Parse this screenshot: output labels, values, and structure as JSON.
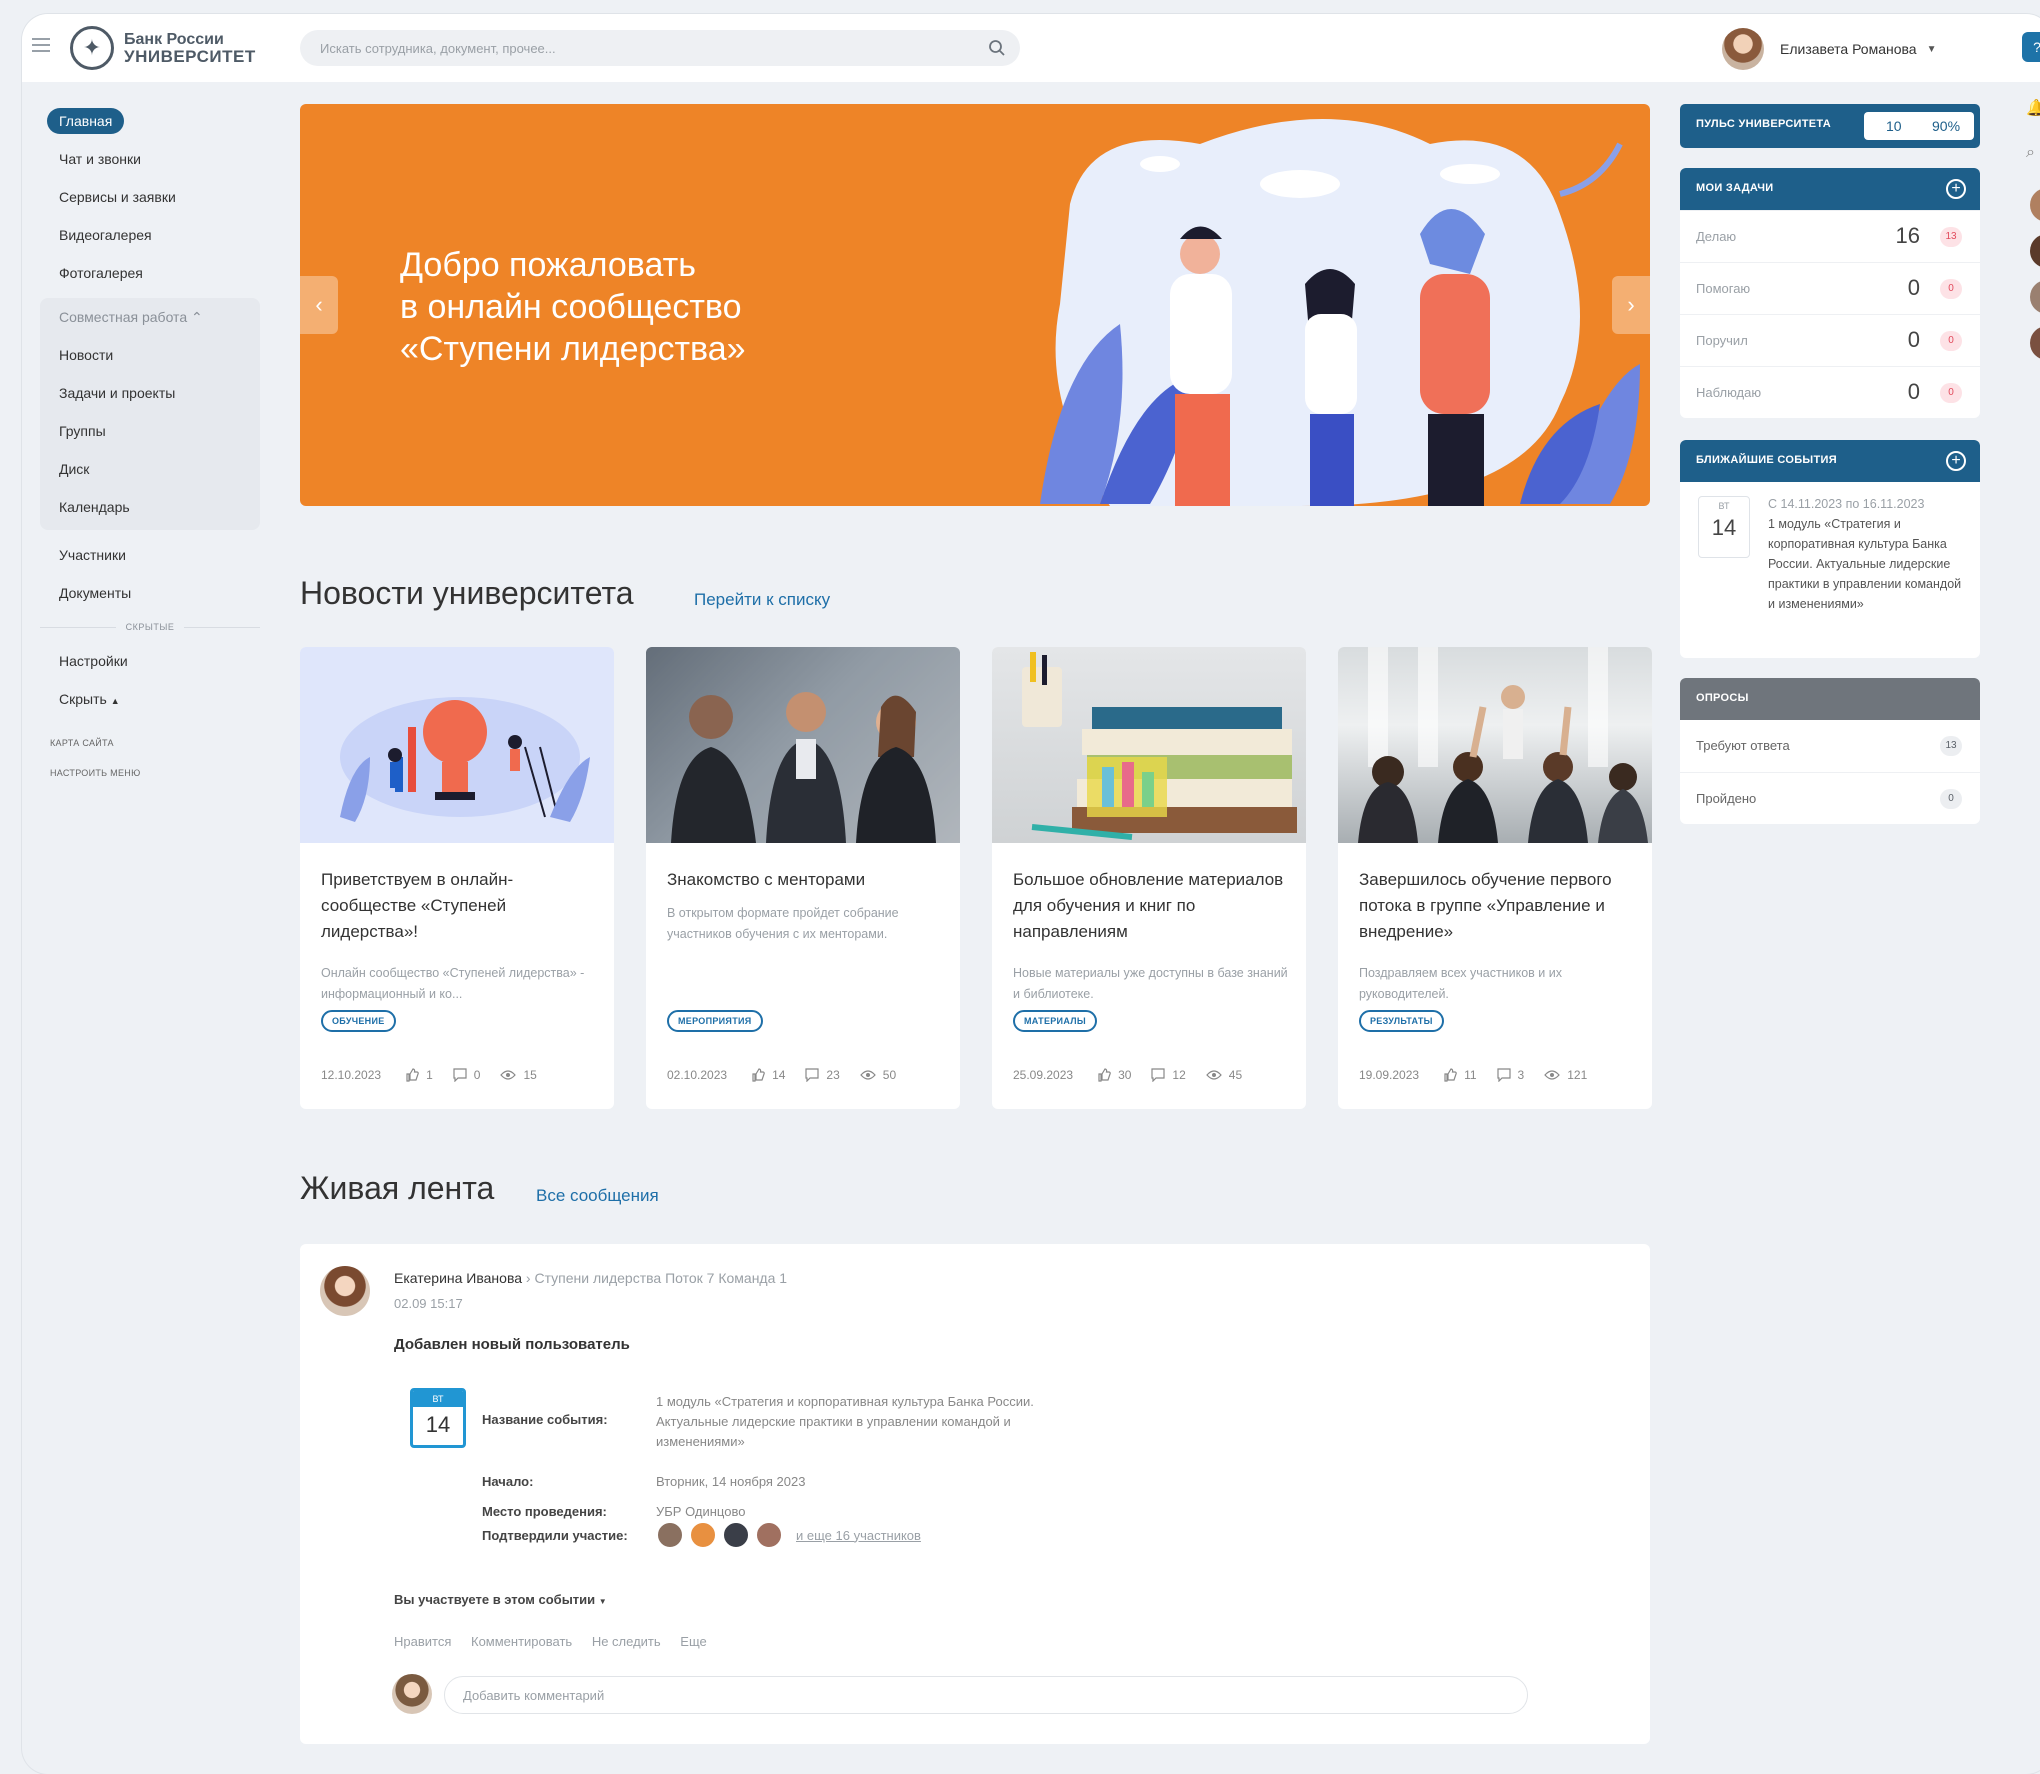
{
  "header": {
    "logo_line1": "Банк России",
    "logo_line2": "УНИВЕРСИТЕТ",
    "search_placeholder": "Искать сотрудника, документ, прочее...",
    "user_name": "Елизавета Романова",
    "help_label": "?"
  },
  "sidebar": {
    "items_top": [
      {
        "label": "Главная",
        "active": true
      },
      {
        "label": "Чат и звонки"
      },
      {
        "label": "Сервисы и заявки"
      },
      {
        "label": "Видеогалерея"
      },
      {
        "label": "Фотогалерея"
      }
    ],
    "group": {
      "title": "Совместная работа",
      "items": [
        "Новости",
        "Задачи и проекты",
        "Группы",
        "Диск",
        "Календарь"
      ]
    },
    "items_mid": [
      "Участники",
      "Документы"
    ],
    "hidden_label": "СКРЫТЫЕ",
    "items_bottom": [
      "Настройки",
      "Скрыть"
    ],
    "small_links": [
      "КАРТА САЙТА",
      "НАСТРОИТЬ МЕНЮ"
    ]
  },
  "banner": {
    "line1": "Добро пожаловать",
    "line2": "в онлайн сообщество",
    "line3": "«Ступени лидерства»",
    "bg_color": "#ee8427"
  },
  "news": {
    "heading": "Новости университета",
    "link": "Перейти к списку",
    "cards": [
      {
        "title": "Приветствуем в онлайн-сообществе «Ступеней лидерства»!",
        "desc": "Онлайн сообщество «Ступеней лидерства» - информационный и ко...",
        "tag": "ОБУЧЕНИЕ",
        "date": "12.10.2023",
        "likes": "1",
        "comments": "0",
        "views": "15"
      },
      {
        "title": "Знакомство с менторами",
        "desc": "В открытом формате пройдет собрание участников обучения с их менторами.",
        "tag": "МЕРОПРИЯТИЯ",
        "date": "02.10.2023",
        "likes": "14",
        "comments": "23",
        "views": "50"
      },
      {
        "title": "Большое обновление материалов для обучения и книг по направлениям",
        "desc": "Новые материалы уже доступны в базе знаний и библиотеке.",
        "tag": "МАТЕРИАЛЫ",
        "date": "25.09.2023",
        "likes": "30",
        "comments": "12",
        "views": "45"
      },
      {
        "title": "Завершилось обучение первого потока в группе «Управление и внедрение»",
        "desc": "Поздравляем всех участников и их руководителей.",
        "tag": "РЕЗУЛЬТАТЫ",
        "date": "19.09.2023",
        "likes": "11",
        "comments": "3",
        "views": "121"
      }
    ]
  },
  "pulse": {
    "label": "ПУЛЬС УНИВЕРСИТЕТА",
    "value": "10",
    "percent": "90%"
  },
  "tasks": {
    "title": "МОИ ЗАДАЧИ",
    "rows": [
      {
        "name": "Делаю",
        "value": "16",
        "badge": "13"
      },
      {
        "name": "Помогаю",
        "value": "0",
        "badge": "0"
      },
      {
        "name": "Поручил",
        "value": "0",
        "badge": "0"
      },
      {
        "name": "Наблюдаю",
        "value": "0",
        "badge": "0"
      }
    ]
  },
  "events": {
    "title": "БЛИЖАЙШИЕ СОБЫТИЯ",
    "day_of_week": "ВТ",
    "day": "14",
    "date_range": "С 14.11.2023 по 16.11.2023",
    "text": "1 модуль «Стратегия и корпоративная культура Банка России. Актуальные лидерские практики в управлении командой и изменениями»"
  },
  "polls": {
    "title": "ОПРОСЫ",
    "rows": [
      {
        "name": "Требуют ответа",
        "badge": "13"
      },
      {
        "name": "Пройдено",
        "badge": "0"
      }
    ]
  },
  "feed": {
    "heading": "Живая лента",
    "link": "Все сообщения",
    "author": "Екатерина Иванова",
    "crumb": "Ступени лидерства Поток 7 Команда 1",
    "time": "02.09 15:17",
    "post_title": "Добавлен новый пользователь",
    "cal_dow": "ВТ",
    "cal_day": "14",
    "event_name_label": "Название события:",
    "event_name": "1 модуль «Стратегия и корпоративная культура Банка России. Актуальные лидерские практики в управлении командой и изменениями»",
    "start_label": "Начало:",
    "start": "Вторник, 14 ноября 2023",
    "place_label": "Место проведения:",
    "place": "УБР Одинцово",
    "confirmed_label": "Подтвердили участие:",
    "more_participants": "и еще 16 участников",
    "participate": "Вы участвуете в этом событии",
    "actions": [
      "Нравится",
      "Комментировать",
      "Не следить",
      "Еще"
    ],
    "comment_placeholder": "Добавить комментарий"
  }
}
